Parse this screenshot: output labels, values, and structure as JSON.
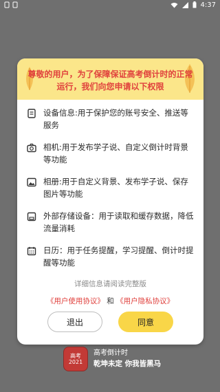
{
  "status_bar": {
    "time": "4:37"
  },
  "dialog": {
    "title": "尊敬的用户，为了保障保证高考倒计时的正常运行，我们向您申请以下权限",
    "permissions": [
      {
        "icon": "document-icon",
        "text": "设备信息:用于保护您的账号安全、推送等服务"
      },
      {
        "icon": "camera-icon",
        "text": "相机:用于发布学子说、自定义倒计时背景等功能"
      },
      {
        "icon": "image-icon",
        "text": "相册:用于自定义背景、发布学子说、保存图片等功能"
      },
      {
        "icon": "storage-icon",
        "text": "外部存储设备：用于读取和缓存数据，降低流量消耗"
      },
      {
        "icon": "calendar-icon",
        "text": "日历：用于任务提醒，学习提醒、倒计时提醒等功能"
      }
    ],
    "detail_hint": "详细信息请阅读完整版",
    "agreement_user": "《用户使用协议》",
    "agreement_and": "和",
    "agreement_privacy": "《用户隐私协议》",
    "exit_label": "退出",
    "agree_label": "同意"
  },
  "splash": {
    "logo_text_top": "高考",
    "logo_text_bottom": "2021",
    "app_name": "高考倒计时",
    "slogan": "乾坤未定 你我皆黑马"
  },
  "colors": {
    "overlay": "#6f6f6f",
    "header_bg": "#fbe68a",
    "title_red": "#e0413d",
    "agree_yellow": "#f9d648"
  }
}
